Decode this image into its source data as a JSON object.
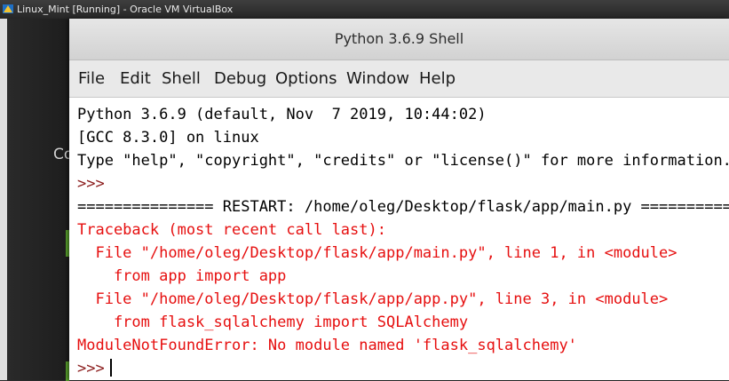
{
  "host": {
    "window_title": "Linux_Mint [Running] - Oracle VM VirtualBox",
    "desktop_partial_label": "Co"
  },
  "idle": {
    "title": "Python 3.6.9 Shell",
    "menu": {
      "items": [
        "File",
        "Edit",
        "Shell",
        "Debug",
        "Options",
        "Window",
        "Help"
      ]
    },
    "shell": {
      "lines": [
        "Python 3.6.9 (default, Nov  7 2019, 10:44:02)",
        "[GCC 8.3.0] on linux",
        "Type \"help\", \"copyright\", \"credits\" or \"license()\" for more information.",
        ">>>",
        "=============== RESTART: /home/oleg/Desktop/flask/app/main.py ===========",
        "Traceback (most recent call last):",
        "  File \"/home/oleg/Desktop/flask/app/main.py\", line 1, in <module>",
        "    from app import app",
        "  File \"/home/oleg/Desktop/flask/app/app.py\", line 3, in <module>",
        "    from flask_sqlalchemy import SQLAlchemy",
        "ModuleNotFoundError: No module named 'flask_sqlalchemy'",
        ">>>"
      ]
    }
  },
  "colors": {
    "error_text": "#e60f0f",
    "prompt_text": "#8b1c1c",
    "output_text": "#000000"
  }
}
